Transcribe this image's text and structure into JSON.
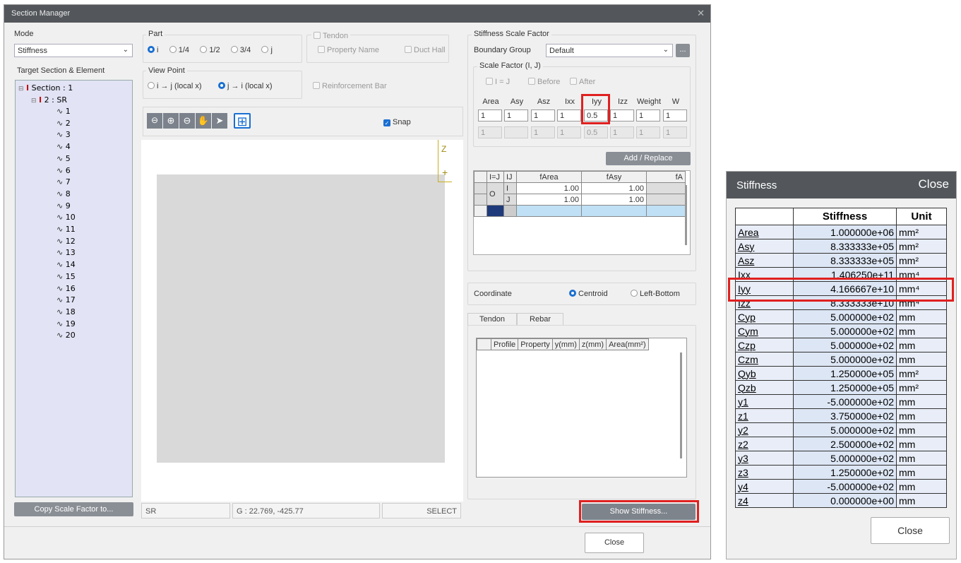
{
  "window": {
    "title": "Section Manager",
    "close": "✕"
  },
  "mode": {
    "label": "Mode",
    "value": "Stiffness"
  },
  "part": {
    "label": "Part",
    "options": [
      "i",
      "1/4",
      "1/2",
      "3/4",
      "j"
    ]
  },
  "tendon": {
    "label": "Tendon",
    "property_name": "Property Name",
    "duct_hall": "Duct Hall"
  },
  "target": {
    "label": "Target Section & Element",
    "section": "Section : 1",
    "sub": "2 : SR",
    "elements": [
      "1",
      "2",
      "3",
      "4",
      "5",
      "6",
      "7",
      "8",
      "9",
      "10",
      "11",
      "12",
      "13",
      "14",
      "15",
      "16",
      "17",
      "18",
      "19",
      "20"
    ]
  },
  "viewpoint": {
    "label": "View Point",
    "opt1": "i → j (local x)",
    "opt2": "j → i (local x)"
  },
  "reinforcement": "Reinforcement Bar",
  "snap": "Snap",
  "axis": {
    "z": "Z",
    "plus": "+"
  },
  "status": {
    "section": "SR",
    "coord": "G : 22.769, -425.77",
    "mode": "SELECT"
  },
  "copy_button": "Copy Scale Factor to...",
  "ssf": {
    "label": "Stiffness Scale Factor",
    "boundary_group_label": "Boundary Group",
    "boundary_group": "Default",
    "more": "...",
    "scale_label": "Scale Factor (I, J)",
    "i_eq_j": "I = J",
    "before": "Before",
    "after": "After",
    "headers": [
      "Area",
      "Asy",
      "Asz",
      "Ixx",
      "Iyy",
      "Izz",
      "Weight",
      "W"
    ],
    "values": [
      "1",
      "1",
      "1",
      "1",
      "0.5",
      "1",
      "1",
      "1"
    ],
    "values2": [
      "1",
      "",
      "1",
      "1",
      "0.5",
      "1",
      "1",
      "1"
    ],
    "add_replace": "Add / Replace"
  },
  "grid": {
    "headers": [
      "I=J",
      "IJ",
      "fArea",
      "fAsy",
      "fA"
    ],
    "rows": [
      {
        "ij": "I",
        "farea": "1.00",
        "fasy": "1.00"
      },
      {
        "ij": "J",
        "farea": "1.00",
        "fasy": "1.00"
      }
    ],
    "o": "O"
  },
  "coordinate": {
    "label": "Coordinate",
    "centroid": "Centroid",
    "left_bottom": "Left-Bottom"
  },
  "tabs": [
    "Tendon",
    "Rebar"
  ],
  "rebar_table": {
    "headers": [
      "Profile",
      "Property",
      "y(mm)",
      "z(mm)",
      "Area(mm²)"
    ]
  },
  "show_stiffness": "Show Stiffness...",
  "close": "Close",
  "stiffness_window": {
    "title": "Stiffness",
    "close": "Close",
    "headers": [
      "",
      "Stiffness",
      "Unit"
    ],
    "rows": [
      {
        "name": "Area",
        "value": "1.000000e+06",
        "unit": "mm²"
      },
      {
        "name": "Asy",
        "value": "8.333333e+05",
        "unit": "mm²"
      },
      {
        "name": "Asz",
        "value": "8.333333e+05",
        "unit": "mm²"
      },
      {
        "name": "Ixx",
        "value": "1.406250e+11",
        "unit": "mm⁴"
      },
      {
        "name": "Iyy",
        "value": "4.166667e+10",
        "unit": "mm⁴"
      },
      {
        "name": "Izz",
        "value": "8.333333e+10",
        "unit": "mm⁴"
      },
      {
        "name": "Cyp",
        "value": "5.000000e+02",
        "unit": "mm"
      },
      {
        "name": "Cym",
        "value": "5.000000e+02",
        "unit": "mm"
      },
      {
        "name": "Czp",
        "value": "5.000000e+02",
        "unit": "mm"
      },
      {
        "name": "Czm",
        "value": "5.000000e+02",
        "unit": "mm"
      },
      {
        "name": "Qyb",
        "value": "1.250000e+05",
        "unit": "mm²"
      },
      {
        "name": "Qzb",
        "value": "1.250000e+05",
        "unit": "mm²"
      },
      {
        "name": "y1",
        "value": "-5.000000e+02",
        "unit": "mm"
      },
      {
        "name": "z1",
        "value": "3.750000e+02",
        "unit": "mm"
      },
      {
        "name": "y2",
        "value": "5.000000e+02",
        "unit": "mm"
      },
      {
        "name": "z2",
        "value": "2.500000e+02",
        "unit": "mm"
      },
      {
        "name": "y3",
        "value": "5.000000e+02",
        "unit": "mm"
      },
      {
        "name": "z3",
        "value": "1.250000e+02",
        "unit": "mm"
      },
      {
        "name": "y4",
        "value": "-5.000000e+02",
        "unit": "mm"
      },
      {
        "name": "z4",
        "value": "0.000000e+00",
        "unit": "mm"
      }
    ]
  }
}
